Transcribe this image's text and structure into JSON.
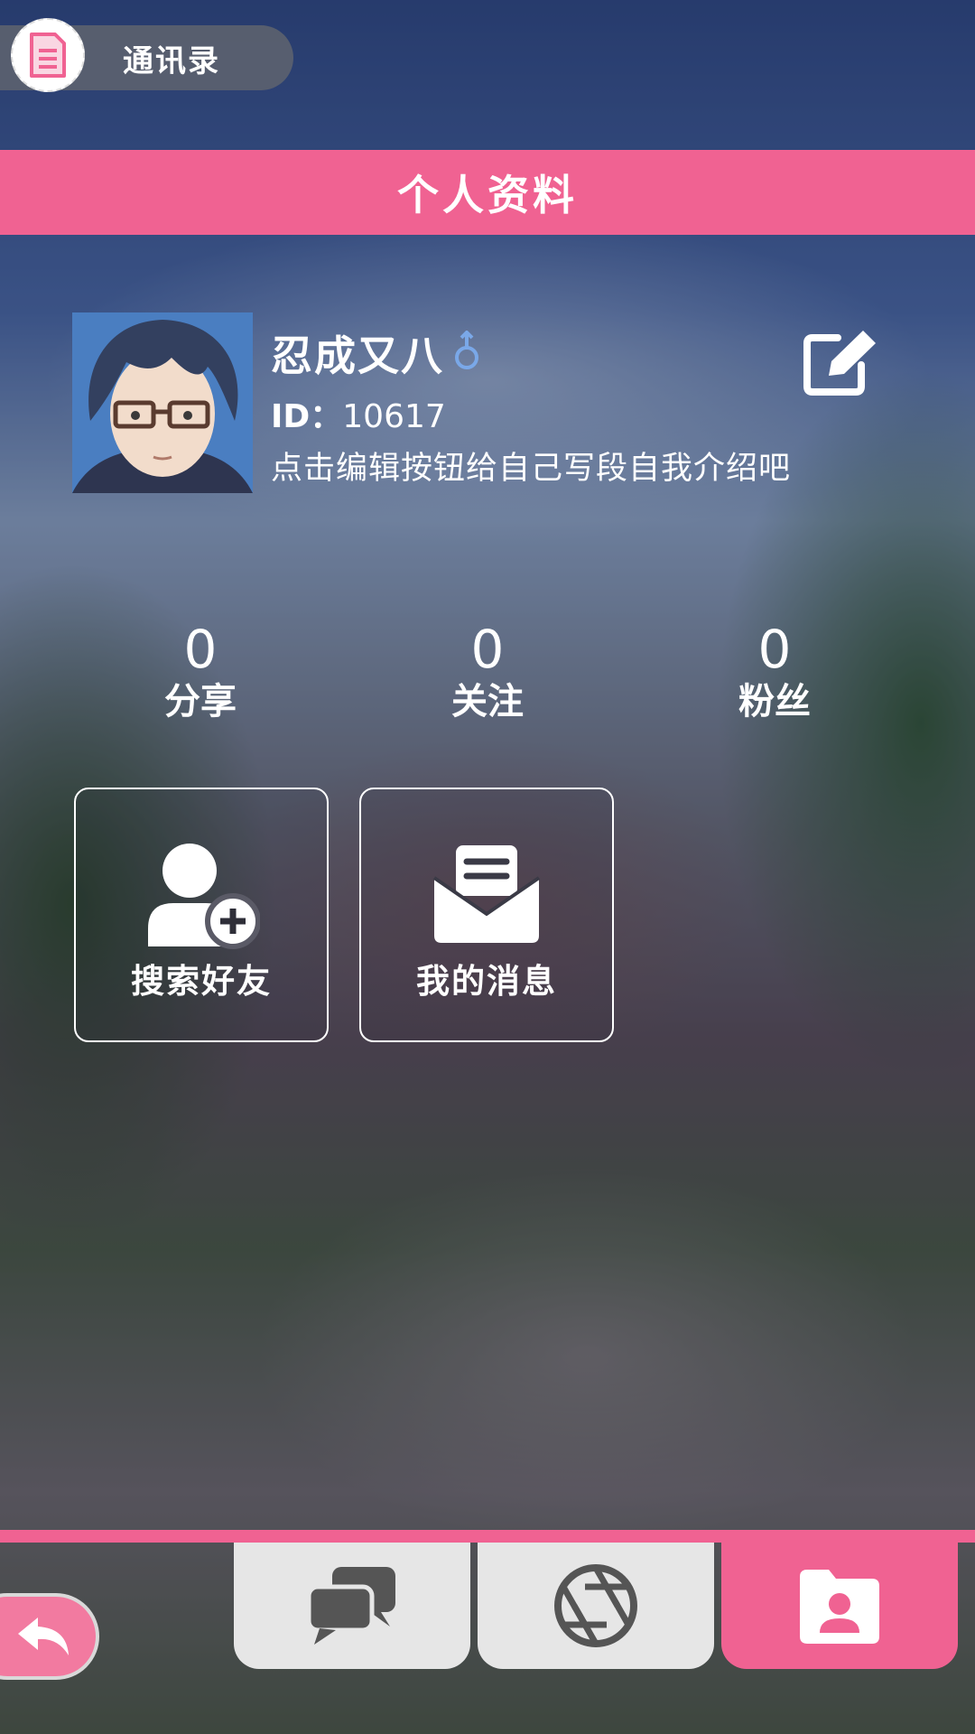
{
  "header": {
    "contacts_label": "通讯录"
  },
  "title_bar": {
    "title": "个人资料"
  },
  "profile": {
    "name": "忍成又八",
    "gender_symbol": "♂",
    "id_label": "ID：",
    "id_value": "10617",
    "bio": "点击编辑按钮给自己写段自我介绍吧"
  },
  "stats": [
    {
      "value": "0",
      "label": "分享"
    },
    {
      "value": "0",
      "label": "关注"
    },
    {
      "value": "0",
      "label": "粉丝"
    }
  ],
  "actions": [
    {
      "label": "搜索好友",
      "icon": "add-user-icon"
    },
    {
      "label": "我的消息",
      "icon": "envelope-icon"
    }
  ],
  "bottom_nav": {
    "tabs": [
      {
        "icon": "chat-bubbles-icon",
        "active": false
      },
      {
        "icon": "aperture-icon",
        "active": false
      },
      {
        "icon": "profile-folder-icon",
        "active": true
      }
    ],
    "back_icon": "back-arrow-icon"
  },
  "colors": {
    "accent": "#f06292",
    "tab_inactive": "#e6e6e6",
    "icon_gray": "#555555",
    "male_blue": "#7aa8e8"
  }
}
